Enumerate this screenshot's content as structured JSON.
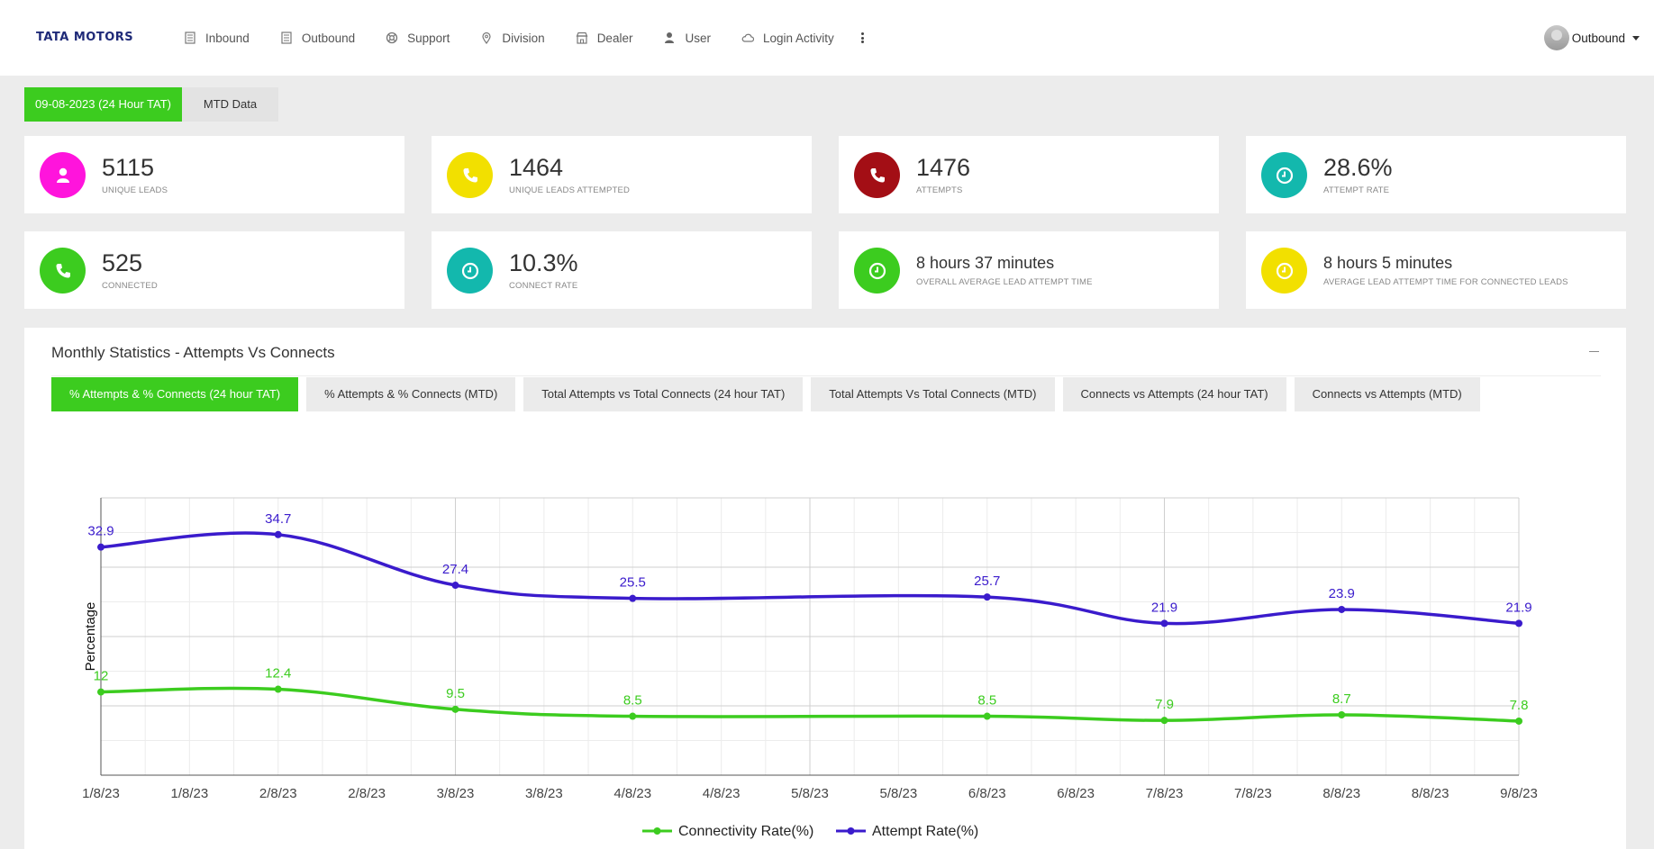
{
  "brand": {
    "logo_text": "TATA MOTORS"
  },
  "nav": {
    "items": [
      {
        "label": "Inbound",
        "icon": "building-icon"
      },
      {
        "label": "Outbound",
        "icon": "building-icon"
      },
      {
        "label": "Support",
        "icon": "lifebuoy-icon"
      },
      {
        "label": "Division",
        "icon": "map-pin-icon"
      },
      {
        "label": "Dealer",
        "icon": "store-icon"
      },
      {
        "label": "User",
        "icon": "user-icon"
      },
      {
        "label": "Login Activity",
        "icon": "cloud-icon"
      }
    ],
    "more_icon": "vertical-dots-icon"
  },
  "user_menu": {
    "label": "Outbound"
  },
  "date_tabs": {
    "active": "09-08-2023  (24 Hour TAT)",
    "inactive": "MTD Data"
  },
  "stats": [
    {
      "value": "5115",
      "label": "UNIQUE LEADS",
      "icon": "user-icon",
      "color": "#ff14dc"
    },
    {
      "value": "1464",
      "label": "UNIQUE LEADS ATTEMPTED",
      "icon": "phone-icon",
      "color": "#f2e000"
    },
    {
      "value": "1476",
      "label": "ATTEMPTS",
      "icon": "phone-icon",
      "color": "#a30e15"
    },
    {
      "value": "28.6%",
      "label": "ATTEMPT RATE",
      "icon": "clock-icon",
      "color": "#13b8ad"
    },
    {
      "value": "525",
      "label": "CONNECTED",
      "icon": "phone-icon",
      "color": "#3ccc1f"
    },
    {
      "value": "10.3%",
      "label": "CONNECT RATE",
      "icon": "clock-icon",
      "color": "#13b8ad"
    },
    {
      "value": "8 hours 37 minutes",
      "label": "OVERALL AVERAGE LEAD ATTEMPT TIME",
      "icon": "clock-icon",
      "color": "#3ccc1f"
    },
    {
      "value": "8 hours 5 minutes",
      "label": "AVERAGE LEAD ATTEMPT TIME FOR CONNECTED LEADS",
      "icon": "clock-icon",
      "color": "#f2e000"
    }
  ],
  "panel": {
    "title": "Monthly Statistics - Attempts Vs Connects",
    "tabs": [
      "% Attempts & % Connects (24 hour TAT)",
      "% Attempts & % Connects (MTD)",
      "Total Attempts vs Total Connects (24 hour TAT)",
      "Total Attempts Vs Total Connects (MTD)",
      "Connects vs Attempts (24 hour TAT)",
      "Connects vs Attempts (MTD)"
    ]
  },
  "chart_data": {
    "type": "line",
    "title": "",
    "xlabel": "",
    "ylabel": "Percentage",
    "x_tick_labels": [
      "1/8/23",
      "1/8/23",
      "2/8/23",
      "2/8/23",
      "3/8/23",
      "3/8/23",
      "4/8/23",
      "4/8/23",
      "5/8/23",
      "5/8/23",
      "6/8/23",
      "6/8/23",
      "7/8/23",
      "7/8/23",
      "8/8/23",
      "8/8/23",
      "9/8/23"
    ],
    "x": [
      "1/8/23",
      "2/8/23",
      "3/8/23",
      "4/8/23",
      "6/8/23",
      "7/8/23",
      "8/8/23",
      "9/8/23"
    ],
    "x_positions_days": [
      1,
      2,
      3,
      4,
      6,
      7,
      8,
      9
    ],
    "ylim": [
      0,
      40
    ],
    "grid": true,
    "legend_position": "bottom-center",
    "series": [
      {
        "name": "Connectivity Rate(%)",
        "color": "#3ccc1f",
        "values": [
          12,
          12.4,
          9.5,
          8.5,
          8.5,
          7.9,
          8.7,
          7.8
        ]
      },
      {
        "name": "Attempt Rate(%)",
        "color": "#3a1bcc",
        "values": [
          32.9,
          34.7,
          27.4,
          25.5,
          25.7,
          21.9,
          23.9,
          21.9
        ]
      }
    ]
  }
}
